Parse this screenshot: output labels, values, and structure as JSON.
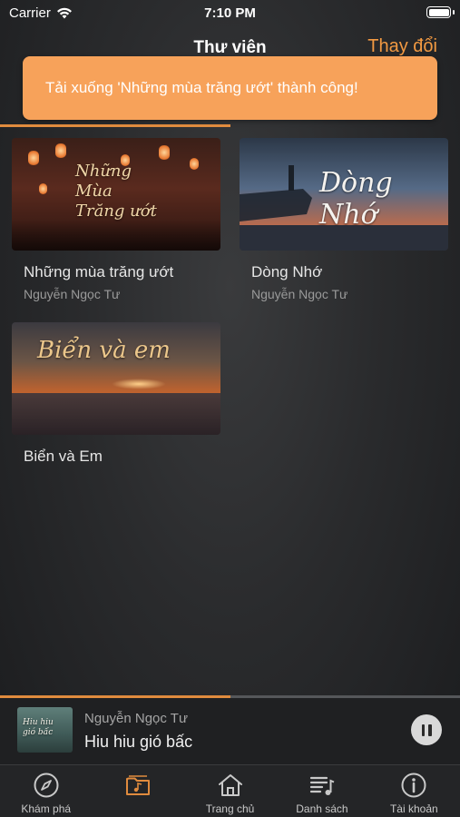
{
  "status_bar": {
    "carrier": "Carrier",
    "time": "7:10 PM"
  },
  "navbar": {
    "title": "Thư viên",
    "action": "Thay đổi"
  },
  "toast": {
    "message": "Tải xuống 'Những mùa trăng ướt' thành công!"
  },
  "library": {
    "items": [
      {
        "title": "Những mùa trăng ướt",
        "author": "Nguyễn Ngọc Tư",
        "cover_text": "Những Mùa Trăng ướt"
      },
      {
        "title": "Dòng Nhớ",
        "author": "Nguyễn Ngọc Tư",
        "cover_text": "Dòng Nhớ"
      },
      {
        "title": "Biển và Em",
        "author": "",
        "cover_text": "Biển và em"
      }
    ]
  },
  "mini_player": {
    "artist": "Nguyễn Ngọc Tư",
    "song": "Hiu hiu gió bấc",
    "progress": 0.5,
    "art_text": "Hiu hiu gió bấc"
  },
  "tab_bar": {
    "active_index": 1,
    "tabs": [
      {
        "label": "Khám phá",
        "icon": "compass-icon"
      },
      {
        "label": "",
        "icon": "music-folder-icon"
      },
      {
        "label": "Trang chủ",
        "icon": "home-icon"
      },
      {
        "label": "Danh sách",
        "icon": "playlist-icon"
      },
      {
        "label": "Tài khoản",
        "icon": "info-icon"
      }
    ]
  },
  "colors": {
    "accent": "#e08b3e",
    "toast": "#f7a25a",
    "action": "#f39a42"
  }
}
